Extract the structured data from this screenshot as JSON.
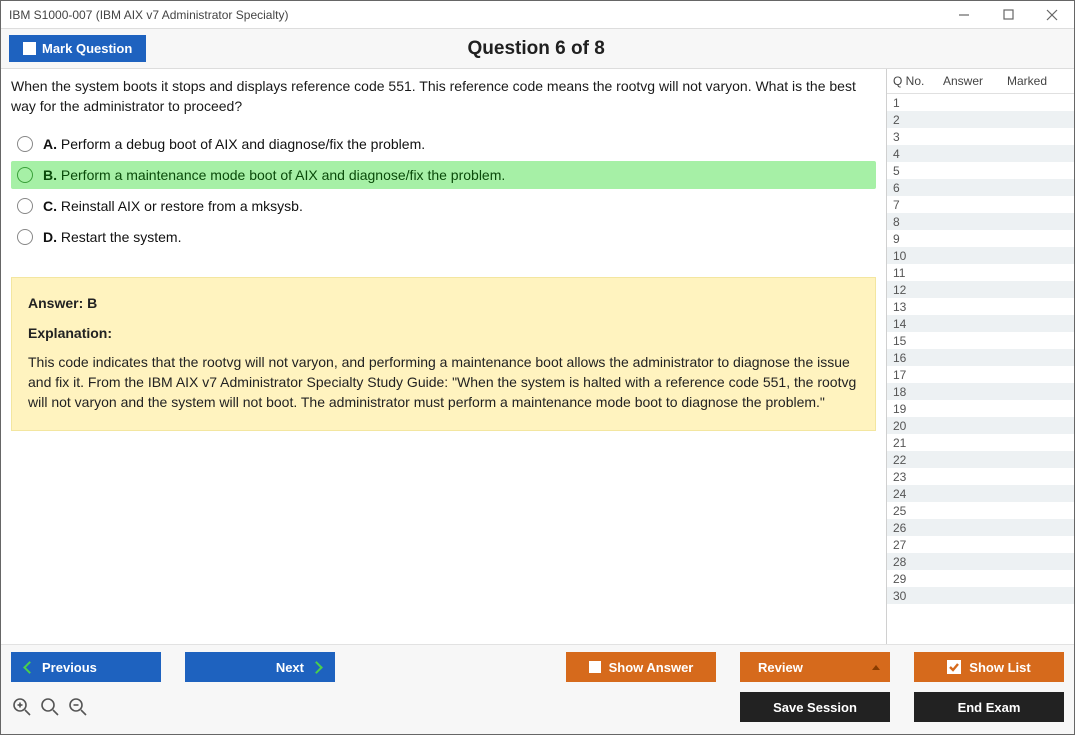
{
  "window": {
    "title": "IBM S1000-007 (IBM AIX v7 Administrator Specialty)"
  },
  "header": {
    "mark_label": "Mark Question",
    "question_number": "Question 6 of 8"
  },
  "question": {
    "text": "When the system boots it stops and displays reference code 551. This reference code means the rootvg will not varyon. What is the best way for the administrator to proceed?",
    "options": [
      {
        "letter": "A.",
        "text": "Perform a debug boot of AIX and diagnose/fix the problem.",
        "correct": false
      },
      {
        "letter": "B.",
        "text": "Perform a maintenance mode boot of AIX and diagnose/fix the problem.",
        "correct": true
      },
      {
        "letter": "C.",
        "text": "Reinstall AIX or restore from a mksysb.",
        "correct": false
      },
      {
        "letter": "D.",
        "text": "Restart the system.",
        "correct": false
      }
    ]
  },
  "answer_panel": {
    "answer_heading": "Answer: B",
    "explanation_heading": "Explanation:",
    "explanation_body": "This code indicates that the rootvg will not varyon, and performing a maintenance boot allows the administrator to diagnose the issue and fix it. From the IBM AIX v7 Administrator Specialty Study Guide: \"When the system is halted with a reference code 551, the rootvg will not varyon and the system will not boot. The administrator must perform a maintenance mode boot to diagnose the problem.\""
  },
  "sidelist": {
    "head_qno": "Q No.",
    "head_answer": "Answer",
    "head_marked": "Marked",
    "rows": [
      "1",
      "2",
      "3",
      "4",
      "5",
      "6",
      "7",
      "8",
      "9",
      "10",
      "11",
      "12",
      "13",
      "14",
      "15",
      "16",
      "17",
      "18",
      "19",
      "20",
      "21",
      "22",
      "23",
      "24",
      "25",
      "26",
      "27",
      "28",
      "29",
      "30"
    ]
  },
  "footer": {
    "previous": "Previous",
    "next": "Next",
    "show_answer": "Show Answer",
    "review": "Review",
    "show_list": "Show List",
    "save_session": "Save Session",
    "end_exam": "End Exam"
  }
}
